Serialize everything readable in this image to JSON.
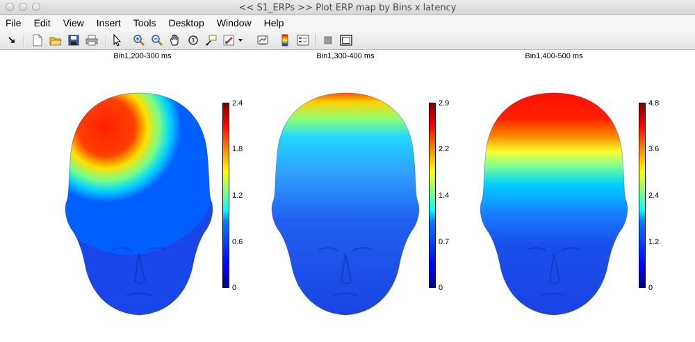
{
  "window": {
    "title": "<< S1_ERPs >>  Plot ERP map by Bins x latency"
  },
  "menu": [
    "File",
    "Edit",
    "View",
    "Insert",
    "Tools",
    "Desktop",
    "Window",
    "Help"
  ],
  "toolbar": {
    "icons": [
      "arrow-icon",
      "new-file-icon",
      "open-folder-icon",
      "save-icon",
      "print-icon",
      "pointer-icon",
      "zoom-in-icon",
      "zoom-out-icon",
      "pan-icon",
      "rotate-3d-icon",
      "data-cursor-icon",
      "brush-icon",
      "dropdown-icon",
      "link-plot-icon",
      "colorbar-icon",
      "legend-icon",
      "hide-tools-icon",
      "show-tools-icon"
    ]
  },
  "plots": [
    {
      "title": "Bin1,200-300 ms",
      "ticks": [
        "2.4",
        "1.8",
        "1.2",
        "0.6",
        "0"
      ],
      "max": 2.4,
      "pattern": "central"
    },
    {
      "title": "Bin1,300-400 ms",
      "ticks": [
        "2.9",
        "2.2",
        "1.4",
        "0.7",
        "0"
      ],
      "max": 2.9,
      "pattern": "frontal-weak"
    },
    {
      "title": "Bin1,400-500 ms",
      "ticks": [
        "4.8",
        "3.6",
        "2.4",
        "1.2",
        "0"
      ],
      "max": 4.8,
      "pattern": "frontal-strong"
    }
  ],
  "colormap": {
    "low": "#00008f",
    "mid": "#00ffff",
    "high": "#ff0000"
  }
}
